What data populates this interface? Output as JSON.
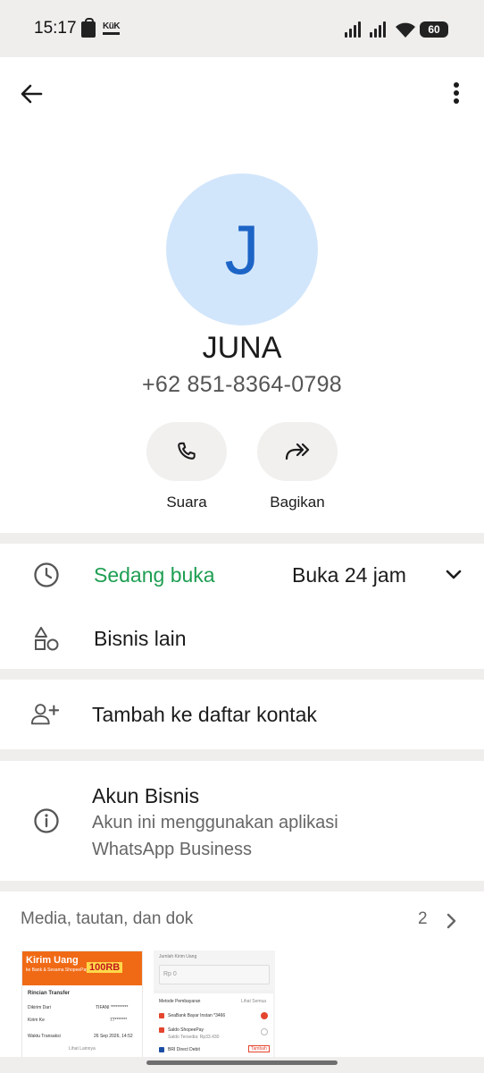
{
  "status_bar": {
    "time": "15:17",
    "kk_label": "KüK",
    "battery": "60"
  },
  "contact": {
    "avatar_letter": "J",
    "name": "JUNA",
    "phone": "+62 851-8364-0798",
    "actions": [
      {
        "label": "Suara",
        "icon": "phone-icon"
      },
      {
        "label": "Bagikan",
        "icon": "share-forward-icon"
      }
    ]
  },
  "business_hours": {
    "status": "Sedang buka",
    "hours": "Buka 24 jam"
  },
  "other_business": {
    "label": "Bisnis lain"
  },
  "add_contact": {
    "label": "Tambah ke daftar kontak"
  },
  "business_account": {
    "title": "Akun Bisnis",
    "description_line1": "Akun ini menggunakan aplikasi",
    "description_line2": "WhatsApp Business"
  },
  "media": {
    "title": "Media, tautan, dan dok",
    "count": "2",
    "thumb1": {
      "banner_title": "Kirim Uang",
      "banner_sub": "ke Bank & Sesama ShopeePay",
      "amount": "100RB",
      "detail_title": "Rincian Transfer",
      "from_label": "Dikirim Dari",
      "from_value": "TIFANI **********",
      "to_label": "Kirim Ke",
      "to_value": "77*******",
      "time_label": "Waktu Transaksi",
      "time_value": "26 Sep 2026, 14:52",
      "more": "Lihat Lainnya"
    },
    "thumb2": {
      "amount_label": "Jumlah Kirim Uang",
      "amount_value": "Rp 0",
      "method_label": "Metode Pembayaran",
      "method_all": "Lihat Semua",
      "option1": "SeaBank Bayar Instan *3466",
      "option2": "Saldo ShopeePay",
      "option2_sub": "Saldo Tersedia: Rp33.430",
      "option3": "BRI Direct Debit",
      "option3_tag": "Tambah"
    }
  },
  "colors": {
    "accent_green": "#1e9e52",
    "avatar_bg": "#d2e6fb",
    "avatar_letter": "#1d64c7"
  }
}
